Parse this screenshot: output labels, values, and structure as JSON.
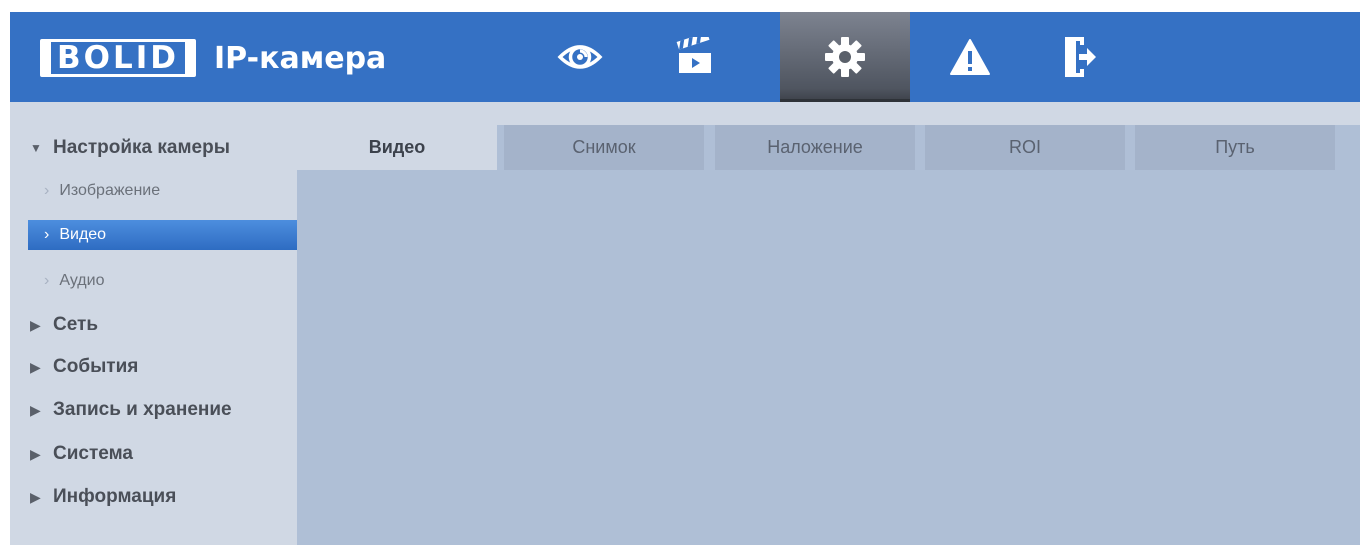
{
  "header": {
    "logo_text": "BOLID",
    "title": "IP-камера",
    "nav": [
      {
        "icon": "eye-icon",
        "label": "Просмотр"
      },
      {
        "icon": "clapperboard-icon",
        "label": "Воспроизведение"
      },
      {
        "icon": "gear-icon",
        "label": "Настройка",
        "active": true
      },
      {
        "icon": "warning-icon",
        "label": "Тревога"
      },
      {
        "icon": "logout-icon",
        "label": "Выход"
      }
    ],
    "colors": {
      "bar": "#3571c4",
      "active": "#4f5560"
    }
  },
  "sidebar": {
    "camera_group": "Настройка камеры",
    "camera_items": [
      "Изображение",
      "Видео",
      "Аудио"
    ],
    "selected_item": "Видео",
    "groups": [
      "Сеть",
      "События",
      "Запись и хранение",
      "Система",
      "Информация"
    ]
  },
  "tabs": [
    {
      "label": "Видео",
      "active": true
    },
    {
      "label": "Снимок"
    },
    {
      "label": "Наложение"
    },
    {
      "label": "ROI"
    },
    {
      "label": "Путь"
    }
  ]
}
